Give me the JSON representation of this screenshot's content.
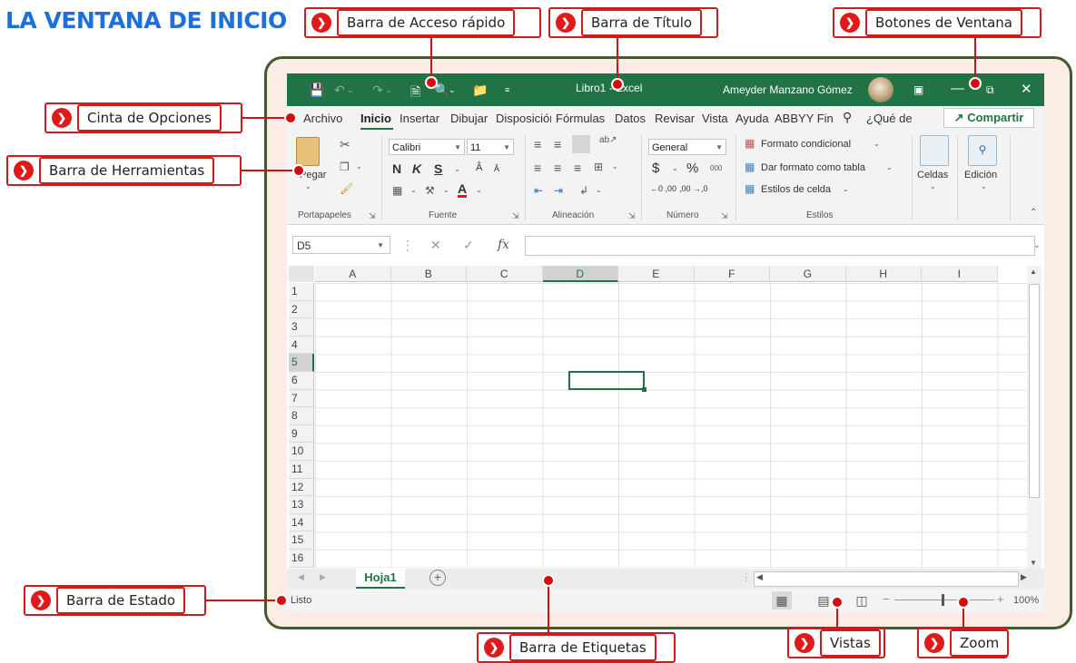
{
  "page_title": "LA VENTANA DE INICIO",
  "callouts": {
    "quick_access": "Barra de Acceso rápido",
    "title_bar": "Barra de Título",
    "window_buttons": "Botones de Ventana",
    "ribbon": "Cinta de Opciones",
    "toolbar": "Barra de Herramientas",
    "status_bar": "Barra de Estado",
    "tabs_bar": "Barra de Etiquetas",
    "views": "Vistas",
    "zoom": "Zoom"
  },
  "window": {
    "doc_title": "Libro1  -  Excel",
    "user_name": "Ameyder Manzano Gómez"
  },
  "menu": {
    "tabs": [
      "Archivo",
      "Inicio",
      "Insertar",
      "Dibujar",
      "Disposición",
      "Fórmulas",
      "Datos",
      "Revisar",
      "Vista",
      "Ayuda",
      "ABBYY Fin"
    ],
    "tell_me": "¿Qué de",
    "share": "Compartir"
  },
  "ribbon": {
    "paste_label": "Pegar",
    "font_name": "Calibri",
    "font_size": "11",
    "bold": "N",
    "italic": "K",
    "underline": "S",
    "number_format": "General",
    "currency": "$",
    "percent": "%",
    "thousands": "000",
    "dec_increase": "←0 ,00",
    "dec_decrease": ",00 →,0",
    "cond_format": "Formato condicional",
    "format_table": "Dar formato como tabla",
    "cell_styles": "Estilos de celda",
    "cells": "Celdas",
    "editing": "Edición",
    "groups": {
      "clipboard": "Portapapeles",
      "font": "Fuente",
      "alignment": "Alineación",
      "number": "Número",
      "styles": "Estilos"
    }
  },
  "formula_bar": {
    "name_box": "D5",
    "fx": "fx"
  },
  "grid": {
    "columns": [
      "A",
      "B",
      "C",
      "D",
      "E",
      "F",
      "G",
      "H",
      "I"
    ],
    "rows": [
      "1",
      "2",
      "3",
      "4",
      "5",
      "6",
      "7",
      "8",
      "9",
      "10",
      "11",
      "12",
      "13",
      "14",
      "15",
      "16"
    ],
    "active_cell": "D5"
  },
  "sheets": {
    "tab": "Hoja1"
  },
  "status": {
    "text": "Listo",
    "zoom": "100%"
  },
  "colors": {
    "excel_green": "#217346",
    "callout_red": "#d11b1b",
    "title_blue": "#1f6fd8",
    "frame_green": "#3f5a2e"
  }
}
